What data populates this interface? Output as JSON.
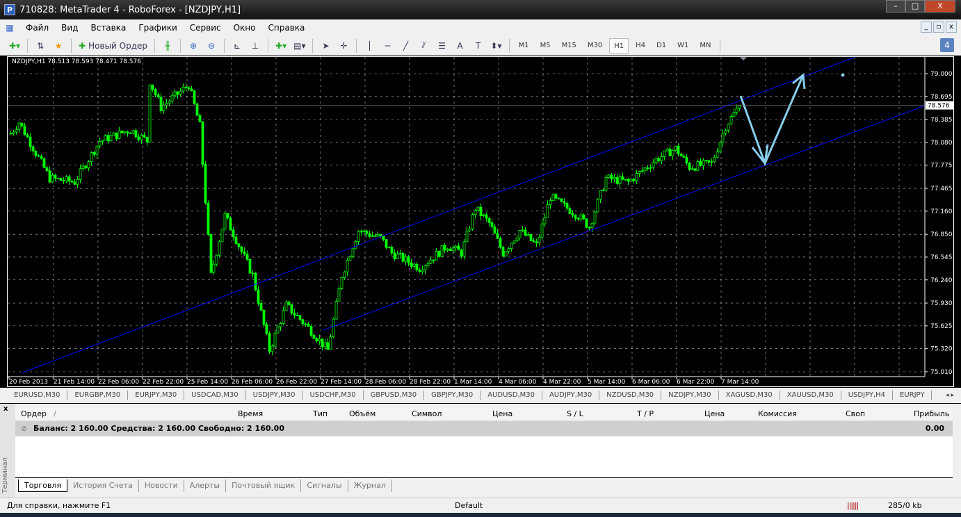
{
  "window": {
    "title": "710828: MetaTrader 4 - RoboForex - [NZDJPY,H1]",
    "min": "–",
    "max": "□",
    "close": "X"
  },
  "menu": [
    "Файл",
    "Вид",
    "Вставка",
    "Графики",
    "Сервис",
    "Окно",
    "Справка"
  ],
  "mdi": {
    "min": "_",
    "restore": "▫",
    "close": "x"
  },
  "toolbar": {
    "new_order": "Новый Ордер",
    "timeframes": [
      "M1",
      "M5",
      "M15",
      "M30",
      "H1",
      "H4",
      "D1",
      "W1",
      "MN"
    ],
    "active_tf": "H1",
    "text_tool": "A",
    "label_tool": "T",
    "notify_count": "4"
  },
  "chart_data": {
    "type": "candlestick",
    "symbol_info": "NZDJPY,H1  78.513 78.593 78.471 78.576",
    "current_price": "78.576",
    "ylim": [
      75.01,
      79.0
    ],
    "yticks": [
      "79.000",
      "78.695",
      "78.385",
      "78.080",
      "77.775",
      "77.465",
      "77.160",
      "76.850",
      "76.545",
      "76.240",
      "75.930",
      "75.625",
      "75.320",
      "75.010"
    ],
    "xticks": [
      "20 Feb 2013",
      "21 Feb 14:00",
      "22 Feb 06:00",
      "22 Feb 22:00",
      "25 Feb 14:00",
      "26 Feb 06:00",
      "26 Feb 22:00",
      "27 Feb 14:00",
      "28 Feb 06:00",
      "28 Feb 22:00",
      "1 Mar 14:00",
      "4 Mar 06:00",
      "4 Mar 22:00",
      "5 Mar 14:00",
      "6 Mar 06:00",
      "6 Mar 22:00",
      "7 Mar 14:00"
    ],
    "approx_close_path": [
      [
        0,
        78.2
      ],
      [
        3,
        78.35
      ],
      [
        14,
        77.6
      ],
      [
        23,
        77.55
      ],
      [
        32,
        78.1
      ],
      [
        43,
        78.25
      ],
      [
        49,
        78.1
      ],
      [
        50,
        78.9
      ],
      [
        54,
        78.55
      ],
      [
        64,
        78.85
      ],
      [
        68,
        78.3
      ],
      [
        72,
        76.3
      ],
      [
        77,
        77.1
      ],
      [
        82,
        76.7
      ],
      [
        87,
        76.3
      ],
      [
        93,
        75.3
      ],
      [
        99,
        75.9
      ],
      [
        107,
        75.6
      ],
      [
        114,
        75.3
      ],
      [
        119,
        76.3
      ],
      [
        125,
        76.9
      ],
      [
        133,
        76.8
      ],
      [
        137,
        76.6
      ],
      [
        147,
        76.4
      ],
      [
        157,
        76.7
      ],
      [
        162,
        76.6
      ],
      [
        167,
        77.2
      ],
      [
        172,
        77.0
      ],
      [
        177,
        76.6
      ],
      [
        183,
        76.9
      ],
      [
        189,
        76.7
      ],
      [
        194,
        77.35
      ],
      [
        204,
        77.1
      ],
      [
        208,
        76.95
      ],
      [
        214,
        77.6
      ],
      [
        222,
        77.55
      ],
      [
        232,
        77.85
      ],
      [
        239,
        78.0
      ],
      [
        244,
        77.75
      ],
      [
        252,
        77.8
      ],
      [
        257,
        78.3
      ],
      [
        262,
        78.576
      ]
    ],
    "colors": {
      "candle": "#00ff00",
      "grid": "#c0c0c0",
      "channel": "#0000ff",
      "arrow": "#87ceeb",
      "background": "#000000"
    }
  },
  "symbol_tabs": [
    "EURUSD,M30",
    "EURGBP,M30",
    "EURJPY,M30",
    "USDCAD,M30",
    "USDJPY,M30",
    "USDCHF,M30",
    "GBPUSD,M30",
    "GBPJPY,M30",
    "AUDUSD,M30",
    "AUDJPY,M30",
    "NZDUSD,M30",
    "NZDJPY,M30",
    "XAGUSD,M30",
    "XAUUSD,M30",
    "USDJPY,H4",
    "EURJPY"
  ],
  "terminal": {
    "side_label": "Терминал",
    "close": "x",
    "columns": [
      "Ордер",
      "/",
      "Время",
      "Тип",
      "Объём",
      "Символ",
      "Цена",
      "S / L",
      "T / P",
      "Цена",
      "Комиссия",
      "Своп",
      "Прибыль"
    ],
    "balance": "Баланс: 2 160.00  Средства: 2 160.00  Свободно: 2 160.00",
    "profit": "0.00",
    "tabs": [
      "Торговля",
      "История Счета",
      "Новости",
      "Алерты",
      "Почтовый ящик",
      "Сигналы",
      "Журнал"
    ]
  },
  "status": {
    "help": "Для справки, нажмите F1",
    "profile": "Default",
    "traffic": "285/0 kb"
  }
}
